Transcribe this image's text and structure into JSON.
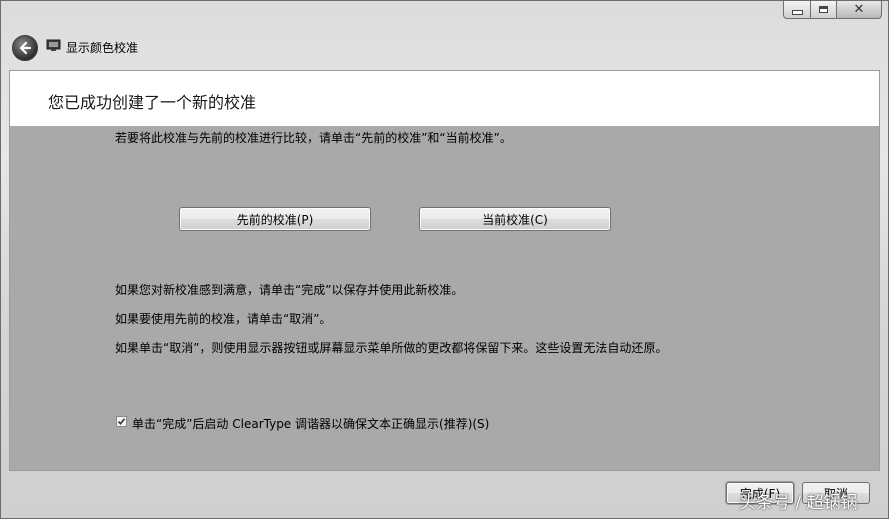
{
  "window": {
    "title": "显示颜色校准"
  },
  "header": {
    "heading": "您已成功创建了一个新的校准"
  },
  "main": {
    "compare_instruction": "若要将此校准与先前的校准进行比较，请单击“先前的校准”和“当前校准”。",
    "previous_button": "先前的校准(P)",
    "current_button": "当前校准(C)",
    "info_lines": [
      "如果您对新校准感到满意，请单击“完成”以保存并使用此新校准。",
      "如果要使用先前的校准，请单击“取消”。",
      "如果单击“取消”，则使用显示器按钮或屏幕显示菜单所做的更改都将保留下来。这些设置无法自动还原。"
    ],
    "cleartype_checkbox": {
      "label": "单击“完成”后启动 ClearType 调谐器以确保文本正确显示(推荐)(S)",
      "checked": true
    }
  },
  "footer": {
    "finish_button": "完成(F)",
    "cancel_button": "取消"
  },
  "watermark": "头条号 / 超锅锅",
  "icons": {
    "back": "back-arrow-icon",
    "app": "monitor-icon",
    "minimize": "minimize-icon",
    "maximize": "maximize-icon",
    "close": "close-icon",
    "check": "checkmark-icon"
  }
}
